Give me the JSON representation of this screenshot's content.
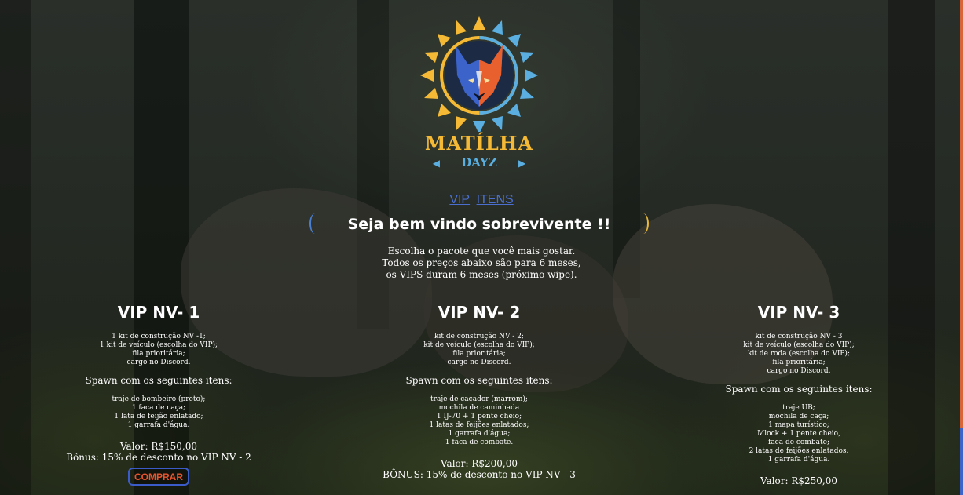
{
  "logo": {
    "title": "MATÍLHA",
    "subtitle": "DAYZ",
    "colors": {
      "sun_yellow": "#f5b935",
      "sun_blue": "#5aaee0",
      "wolf_orange": "#e8602d",
      "wolf_blue": "#3b63c9"
    }
  },
  "nav": {
    "items": [
      "VIP",
      "ITENS"
    ]
  },
  "welcome": {
    "heading": "Seja bem vindo sobrevivente !!"
  },
  "intro": {
    "lines": [
      "Escolha o pacote que você mais gostar.",
      "Todos os preços abaixo são para 6 meses,",
      "os VIPS duram 6 meses (próximo wipe)."
    ]
  },
  "packages": [
    {
      "title": "VIP NV- 1",
      "perks": [
        "1 kit de construção NV -1;",
        "1 kit de veículo (escolha do VIP);",
        "fila prioritária;",
        "cargo no Discord."
      ],
      "spawn_title": "Spawn com os seguintes itens:",
      "items": [
        "traje de bombeiro (preto);",
        "1 faca de caça;",
        "1 lata de feijão enlatado;",
        "1 garrafa d'água."
      ],
      "value": "Valor: R$150,00",
      "bonus": "Bônus: 15% de desconto no VIP NV - 2",
      "button": "COMPRAR"
    },
    {
      "title": "VIP NV- 2",
      "perks": [
        "kit de construção NV - 2;",
        "kit de veículo (escolha do VIP);",
        "fila prioritária;",
        "cargo no Discord."
      ],
      "spawn_title": "Spawn com os seguintes itens:",
      "items": [
        "traje de caçador (marrom);",
        "mochila de caminhada",
        "1 IJ-70 + 1 pente cheio;",
        "1 latas de feijões enlatados;",
        "1 garrafa d'água;",
        "1 faca de combate."
      ],
      "value": "Valor: R$200,00",
      "bonus": "BÔNUS: 15% de desconto no VIP NV - 3"
    },
    {
      "title": "VIP NV- 3",
      "perks": [
        "kit de construção NV - 3",
        "kit de veículo (escolha do VIP);",
        "kit de roda (escolha do VIP);",
        "fila prioritária;",
        "cargo no Discord."
      ],
      "spawn_title": "Spawn com os seguintes itens:",
      "items": [
        "traje UB;",
        "mochila de caça;",
        "1 mapa turístico;",
        "Mlock + 1 pente cheio,",
        "faca de combate;",
        "2 latas de feijões enlatados.",
        "1 garrafa d'água."
      ],
      "value": "Valor: R$250,00"
    }
  ]
}
